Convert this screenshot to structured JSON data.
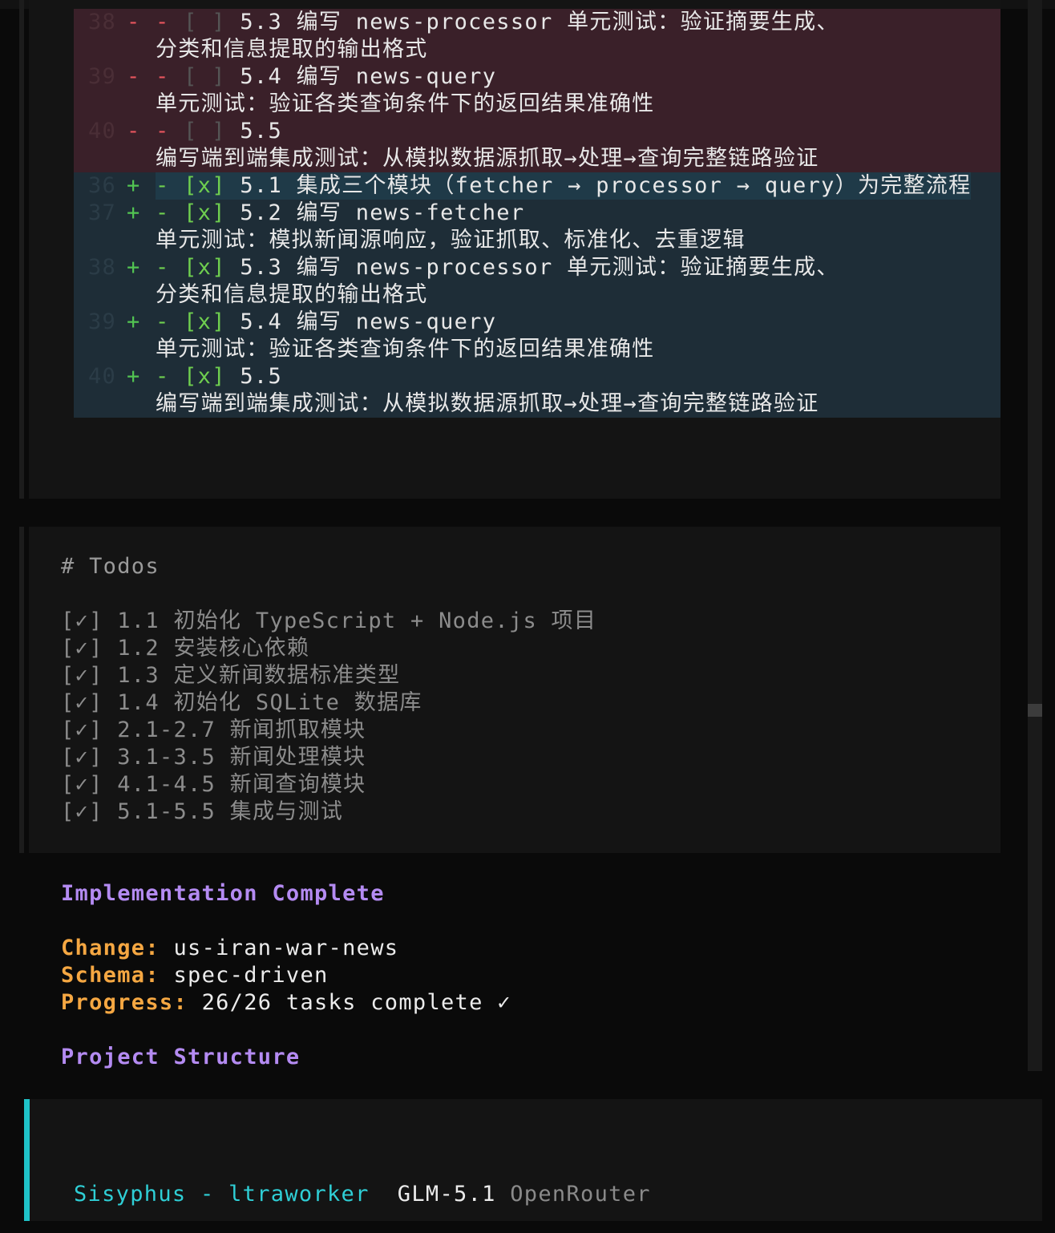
{
  "diff": {
    "removed": [
      {
        "num": "38",
        "sign": "-",
        "dash": "-",
        "box": "[ ]",
        "rows": [
          "5.3 编写 news-processor 单元测试：验证摘要生成、",
          "分类和信息提取的输出格式"
        ]
      },
      {
        "num": "39",
        "sign": "-",
        "dash": "-",
        "box": "[ ]",
        "rows": [
          "5.4 编写 news-query",
          "单元测试：验证各类查询条件下的返回结果准确性"
        ]
      },
      {
        "num": "40",
        "sign": "-",
        "dash": "-",
        "box": "[ ]",
        "rows": [
          "5.5",
          "编写端到端集成测试：从模拟数据源抓取→处理→查询完整链路验证"
        ]
      }
    ],
    "added": [
      {
        "num": "36",
        "sign": "+",
        "dash": "-",
        "box": "[x]",
        "rows": [
          "5.1 集成三个模块（fetcher → processor → query）为完整流程"
        ]
      },
      {
        "num": "37",
        "sign": "+",
        "dash": "-",
        "box": "[x]",
        "rows": [
          "5.2 编写 news-fetcher",
          "单元测试：模拟新闻源响应，验证抓取、标准化、去重逻辑"
        ]
      },
      {
        "num": "38",
        "sign": "+",
        "dash": "-",
        "box": "[x]",
        "rows": [
          "5.3 编写 news-processor 单元测试：验证摘要生成、",
          "分类和信息提取的输出格式"
        ]
      },
      {
        "num": "39",
        "sign": "+",
        "dash": "-",
        "box": "[x]",
        "rows": [
          "5.4 编写 news-query",
          "单元测试：验证各类查询条件下的返回结果准确性"
        ]
      },
      {
        "num": "40",
        "sign": "+",
        "dash": "-",
        "box": "[x]",
        "rows": [
          "5.5",
          "编写端到端集成测试：从模拟数据源抓取→处理→查询完整链路验证"
        ]
      }
    ]
  },
  "todos": {
    "heading": "# Todos",
    "items": [
      "[✓] 1.1 初始化 TypeScript + Node.js 项目",
      "[✓] 1.2 安装核心依赖",
      "[✓] 1.3 定义新闻数据标准类型",
      "[✓] 1.4 初始化 SQLite 数据库",
      "[✓] 2.1-2.7 新闻抓取模块",
      "[✓] 3.1-3.5 新闻处理模块",
      "[✓] 4.1-4.5 新闻查询模块",
      "[✓] 5.1-5.5 集成与测试"
    ]
  },
  "summary": {
    "title": "Implementation Complete",
    "change_label": "Change:",
    "change_value": "us-iran-war-news",
    "schema_label": "Schema:",
    "schema_value": "spec-driven",
    "progress_label": "Progress:",
    "progress_value": "26/26 tasks complete ✓",
    "structure_title": "Project Structure"
  },
  "status": {
    "agent": "Sisyphus - ltraworker",
    "model": "GLM-5.1",
    "provider": "OpenRouter"
  },
  "colors": {
    "removed_bg": "#3a2029",
    "added_bg": "#1e2d37",
    "accent_cyan": "#1fc3c9",
    "heading_purple": "#b48bf2",
    "label_orange": "#f5a742"
  }
}
